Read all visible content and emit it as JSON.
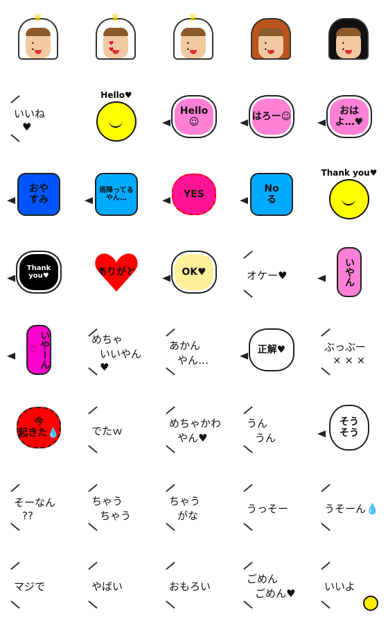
{
  "stickers": [
    {
      "kind": "face",
      "hood": "#ffffff",
      "crown": true,
      "eyes": "• •"
    },
    {
      "kind": "face",
      "hood": "#ffffff",
      "crown": true,
      "eyes": "♥ ♥"
    },
    {
      "kind": "face",
      "hood": "#ffffff",
      "crown": true,
      "eyes": "• •"
    },
    {
      "kind": "face",
      "hood": "#b8541c",
      "crown": false,
      "eyes": "• •"
    },
    {
      "kind": "face",
      "hood": "#111111",
      "crown": false,
      "eyes": "• •"
    },
    {
      "kind": "plain",
      "lines": [
        "いいね",
        "♥"
      ]
    },
    {
      "kind": "smiley",
      "caption": "Hello♥"
    },
    {
      "kind": "bubble",
      "shape": "cloud",
      "bg": "#ff80d5",
      "lines": [
        "Hello",
        "☺"
      ]
    },
    {
      "kind": "bubble",
      "shape": "cloud",
      "bg": "#ff80d5",
      "lines": [
        "はろー☺"
      ]
    },
    {
      "kind": "bubble",
      "shape": "cloud",
      "bg": "#ff80d5",
      "lines": [
        "おは",
        "よ…♥"
      ]
    },
    {
      "kind": "bubble",
      "shape": "square",
      "bg": "#0055ff",
      "lines": [
        "おや",
        "すみ"
      ]
    },
    {
      "kind": "bubble",
      "shape": "square",
      "bg": "#00aaff",
      "lines": [
        "雨降ってる",
        "やん…"
      ]
    },
    {
      "kind": "bubble",
      "shape": "burst",
      "bg": "#ff1493",
      "border": "#ff0000",
      "lines": [
        "YES"
      ]
    },
    {
      "kind": "bubble",
      "shape": "square",
      "bg": "#00aaff",
      "lines": [
        "No",
        "る"
      ]
    },
    {
      "kind": "smiley",
      "caption": "Thank you♥"
    },
    {
      "kind": "bubble",
      "shape": "cloud",
      "bg": "#000000",
      "color": "#ffffff",
      "lines": [
        "Thank",
        "you♥"
      ]
    },
    {
      "kind": "bubble",
      "shape": "heart",
      "bg": "#ff0000",
      "lines": [
        "ありがと"
      ]
    },
    {
      "kind": "bubble",
      "shape": "cloud",
      "bg": "#fff09a",
      "lines": [
        "OK♥"
      ]
    },
    {
      "kind": "plain",
      "lines": [
        "オケー♥"
      ]
    },
    {
      "kind": "bubble",
      "shape": "tall",
      "bg": "#ff80d5",
      "lines": [
        "いやん"
      ]
    },
    {
      "kind": "bubble",
      "shape": "tall",
      "bg": "#ff00cc",
      "lines": [
        "いやーん♡"
      ]
    },
    {
      "kind": "plain",
      "lines": [
        "めちゃ",
        "いいやん♥"
      ]
    },
    {
      "kind": "plain",
      "lines": [
        "あかん",
        "やん…"
      ]
    },
    {
      "kind": "bubble",
      "shape": "cloud",
      "bg": "#ffffff",
      "lines": [
        "正解♥"
      ]
    },
    {
      "kind": "plain",
      "lines": [
        "ぶっぶー",
        "× × ×"
      ]
    },
    {
      "kind": "bubble",
      "shape": "burst",
      "bg": "#ff0000",
      "lines": [
        "今",
        "起きた💧"
      ]
    },
    {
      "kind": "plain",
      "lines": [
        "でたｗ"
      ]
    },
    {
      "kind": "plain",
      "lines": [
        "めちゃかわ",
        "やん♥"
      ]
    },
    {
      "kind": "plain",
      "lines": [
        "うん",
        "うん"
      ]
    },
    {
      "kind": "bubble",
      "shape": "round",
      "bg": "#ffffff",
      "lines": [
        "そう",
        "そう"
      ]
    },
    {
      "kind": "plain",
      "lines": [
        "そーなん",
        "??"
      ]
    },
    {
      "kind": "plain",
      "lines": [
        "ちゃう",
        "ちゃう"
      ]
    },
    {
      "kind": "plain",
      "lines": [
        "ちゃう",
        "がな"
      ]
    },
    {
      "kind": "plain",
      "lines": [
        "うっそー"
      ]
    },
    {
      "kind": "plain",
      "lines": [
        "うそーん💧"
      ]
    },
    {
      "kind": "plain",
      "lines": [
        "マジで"
      ]
    },
    {
      "kind": "plain",
      "lines": [
        "やばい"
      ]
    },
    {
      "kind": "plain",
      "lines": [
        "おもろい"
      ]
    },
    {
      "kind": "plain",
      "lines": [
        "ごめん",
        "ごめん♥"
      ]
    },
    {
      "kind": "plain",
      "lines": [
        "いいよ"
      ],
      "smiley": true
    }
  ]
}
